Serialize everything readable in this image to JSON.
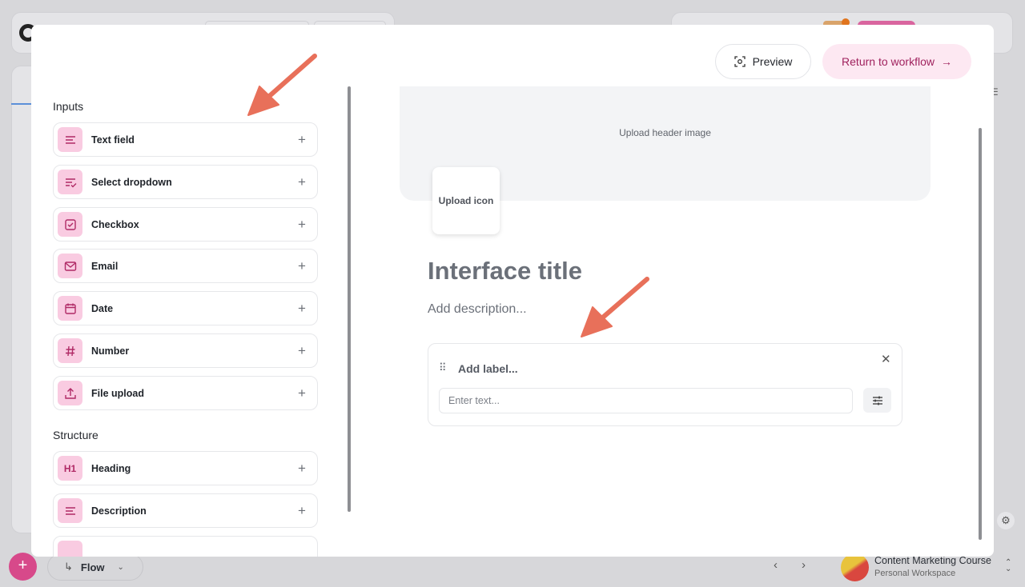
{
  "modal": {
    "preview_label": "Preview",
    "return_label": "Return to workflow",
    "return_arrow": "→",
    "palette": {
      "inputs_title": "Inputs",
      "inputs": [
        {
          "label": "Text field",
          "icon": "text-lines-icon"
        },
        {
          "label": "Select dropdown",
          "icon": "select-list-icon"
        },
        {
          "label": "Checkbox",
          "icon": "checkbox-icon"
        },
        {
          "label": "Email",
          "icon": "envelope-icon"
        },
        {
          "label": "Date",
          "icon": "calendar-icon"
        },
        {
          "label": "Number",
          "icon": "hash-icon"
        },
        {
          "label": "File upload",
          "icon": "upload-icon"
        }
      ],
      "structure_title": "Structure",
      "structure": [
        {
          "label": "Heading",
          "icon": "heading-h1-icon",
          "glyph": "H1"
        },
        {
          "label": "Description",
          "icon": "text-lines-icon"
        }
      ]
    },
    "canvas": {
      "header_image_label": "Upload header image",
      "upload_icon_label": "Upload icon",
      "title": "Interface title",
      "description_placeholder": "Add description...",
      "field": {
        "label_placeholder": "Add label...",
        "input_placeholder": "Enter text..."
      }
    }
  },
  "bottom_bar": {
    "flow_label": "Flow",
    "workspace_name": "Content Marketing Course",
    "workspace_sub": "Personal Workspace"
  },
  "colors": {
    "accent_pink": "#d7498a",
    "icon_bg": "#f9cbe1",
    "annotation_arrow": "#e8705a"
  }
}
